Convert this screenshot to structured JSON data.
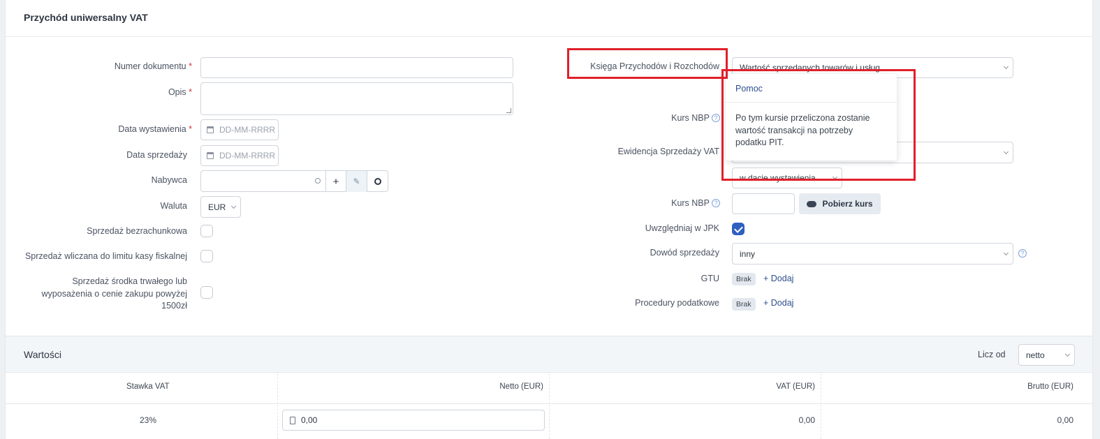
{
  "title": "Przychód uniwersalny VAT",
  "left": {
    "numer_dokumentu": "Numer dokumentu",
    "opis": "Opis",
    "data_wystawienia": "Data wystawienia",
    "data_sprzedazy": "Data sprzedaży",
    "date_placeholder": "DD-MM-RRRR",
    "nabywca": "Nabywca",
    "waluta": "Waluta",
    "waluta_value": "EUR",
    "sprzedaz_bezrachunkowa": "Sprzedaż bezrachunkowa",
    "sprzedaz_limit": "Sprzedaż wliczana do limitu kasy fiskalnej",
    "sprzedaz_srodka_1": "Sprzedaż środka trwałego lub",
    "sprzedaz_srodka_2": "wyposażenia o cenie zakupu powyżej",
    "sprzedaz_srodka_3": "1500zł",
    "required_mark": "*"
  },
  "right": {
    "ksiega": "Księga Przychodów i Rozchodów",
    "ksiega_value": "Wartość sprzedanych towarów i usług",
    "kurs_nbp": "Kurs NBP",
    "ewidencja": "Ewidencja Sprzedaży VAT",
    "w_dacie": "w dacie wystawienia",
    "kurs_nbp2": "Kurs NBP",
    "pobierz_kurs": "Pobierz kurs",
    "uwzgledniaj_jpk": "Uwzględniaj w JPK",
    "dowod_sprzedazy": "Dowód sprzedaży",
    "dowod_value": "inny",
    "gtu": "GTU",
    "procedury": "Procedury podatkowe",
    "brak": "Brak",
    "dodaj": "Dodaj",
    "help_glyph": "?"
  },
  "popover": {
    "title": "Pomoc",
    "line1": "Po tym kursie przeliczona zostanie",
    "line2": "wartość transakcji na potrzeby",
    "line3": "podatku PIT."
  },
  "wartosci": {
    "title": "Wartości",
    "licz_od": "Licz od",
    "licz_od_value": "netto",
    "columns": [
      "Stawka VAT",
      "Netto (EUR)",
      "VAT (EUR)",
      "Brutto (EUR)"
    ],
    "row": {
      "stawka": "23%",
      "netto": "0,00",
      "vat": "0,00",
      "brutto": "0,00"
    }
  },
  "colors": {
    "accent": "#2f5fbf",
    "highlight": "#e0202a"
  }
}
